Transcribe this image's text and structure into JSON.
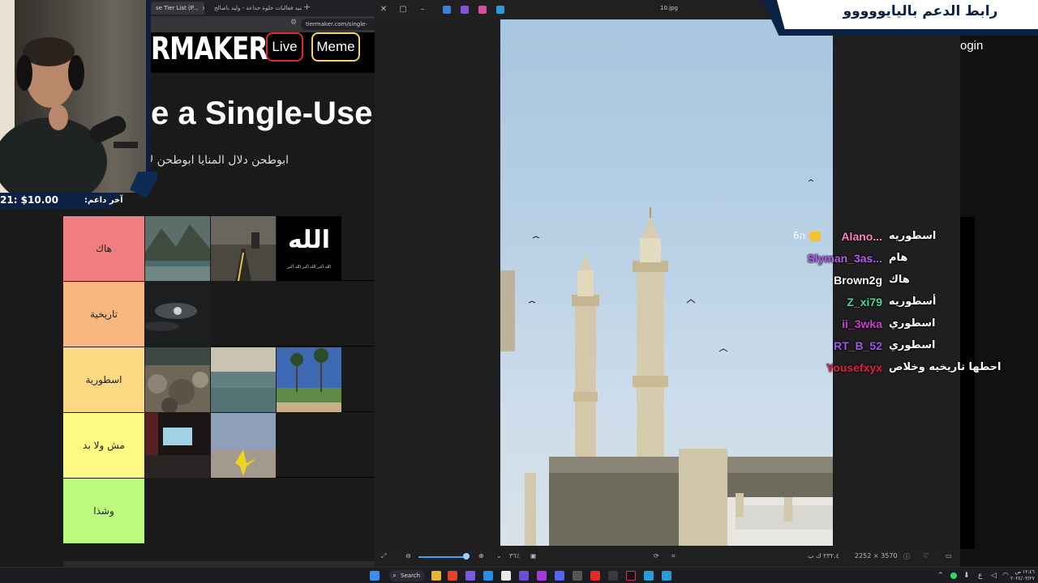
{
  "browser": {
    "tabs": [
      {
        "label": "se Tier List (P..."
      },
      {
        "label": "نشيد فعاليات حلوة جداعة - وليد باصالح"
      }
    ],
    "url": "tiermaker.com/single-",
    "logo_text": "RMAKER",
    "nav": {
      "live": "Live",
      "meme": "Meme",
      "login": "ogin"
    },
    "page_title": "e a Single-Use",
    "subtitle": "ابوطحن دلال المنايا ابوطحن لا"
  },
  "tiers": [
    {
      "label": "هاك",
      "color": "#f07e7e",
      "items": 3
    },
    {
      "label": "تاريخية",
      "color": "#f8b77f",
      "items": 1
    },
    {
      "label": "اسطورية",
      "color": "#fbd982",
      "items": 3
    },
    {
      "label": "مش ولا بد",
      "color": "#fdfb83",
      "items": 2
    },
    {
      "label": "وشذا",
      "color": "#bdfb7e",
      "items": 0
    }
  ],
  "allah_tile": {
    "main": "الله",
    "sub": "الله أكبر الله أكبر الله أكبر"
  },
  "donor": {
    "label": "آخر داعم:",
    "amount": "21: $10.00"
  },
  "support_banner": "رابط الدعم باليايووووو",
  "viewer": {
    "filename": "10.jpg",
    "zoom_label": "٣٦٪",
    "dimensions": "2252 × 3570",
    "size": "٢٣٢.٤ ك ب"
  },
  "chat": [
    {
      "user": "Alano...",
      "color": "#ff83c1",
      "msg": "اسطوريه",
      "badge": "6ה"
    },
    {
      "user": "Slyman_3as...",
      "color": "#b65cf0",
      "msg": "هام"
    },
    {
      "user": "Brown2g",
      "color": "#ffffff",
      "msg": "هاك"
    },
    {
      "user": "Z_xi79",
      "color": "#3fdc9b",
      "msg": "أسطوريه"
    },
    {
      "user": "ii_3wka",
      "color": "#cf3fd6",
      "msg": "اسطوري"
    },
    {
      "user": "RT_B_52",
      "color": "#a357f0",
      "msg": "اسطوري"
    },
    {
      "user": "Yousefxyx",
      "color": "#e02048",
      "msg": "احطها تاريخيه وخلاص"
    }
  ],
  "taskbar": {
    "search_label": "Search",
    "time": "١٢:٤٦ ص",
    "date": "٢٠٢٤/٠٣/٢٧"
  }
}
